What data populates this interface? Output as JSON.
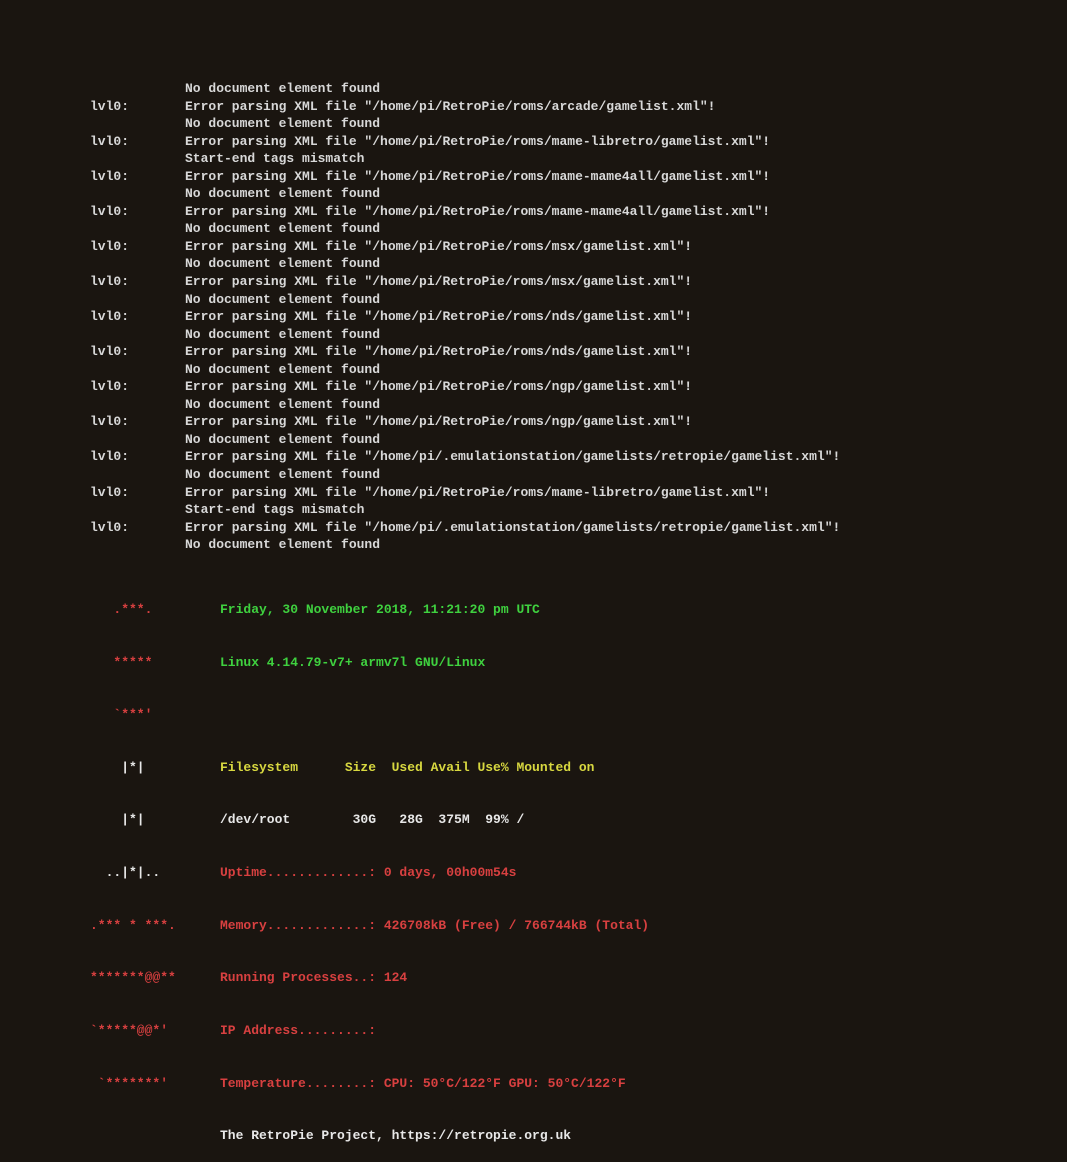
{
  "log_lines": [
    {
      "prefix": "",
      "msg": "No document element found"
    },
    {
      "prefix": "lvl0:",
      "msg": "Error parsing XML file \"/home/pi/RetroPie/roms/arcade/gamelist.xml\"!"
    },
    {
      "prefix": "",
      "msg": "No document element found"
    },
    {
      "prefix": "lvl0:",
      "msg": "Error parsing XML file \"/home/pi/RetroPie/roms/mame-libretro/gamelist.xml\"!"
    },
    {
      "prefix": "",
      "msg": "Start-end tags mismatch"
    },
    {
      "prefix": "lvl0:",
      "msg": "Error parsing XML file \"/home/pi/RetroPie/roms/mame-mame4all/gamelist.xml\"!"
    },
    {
      "prefix": "",
      "msg": "No document element found"
    },
    {
      "prefix": "lvl0:",
      "msg": "Error parsing XML file \"/home/pi/RetroPie/roms/mame-mame4all/gamelist.xml\"!"
    },
    {
      "prefix": "",
      "msg": "No document element found"
    },
    {
      "prefix": "lvl0:",
      "msg": "Error parsing XML file \"/home/pi/RetroPie/roms/msx/gamelist.xml\"!"
    },
    {
      "prefix": "",
      "msg": "No document element found"
    },
    {
      "prefix": "lvl0:",
      "msg": "Error parsing XML file \"/home/pi/RetroPie/roms/msx/gamelist.xml\"!"
    },
    {
      "prefix": "",
      "msg": "No document element found"
    },
    {
      "prefix": "lvl0:",
      "msg": "Error parsing XML file \"/home/pi/RetroPie/roms/nds/gamelist.xml\"!"
    },
    {
      "prefix": "",
      "msg": "No document element found"
    },
    {
      "prefix": "lvl0:",
      "msg": "Error parsing XML file \"/home/pi/RetroPie/roms/nds/gamelist.xml\"!"
    },
    {
      "prefix": "",
      "msg": "No document element found"
    },
    {
      "prefix": "lvl0:",
      "msg": "Error parsing XML file \"/home/pi/RetroPie/roms/ngp/gamelist.xml\"!"
    },
    {
      "prefix": "",
      "msg": "No document element found"
    },
    {
      "prefix": "lvl0:",
      "msg": "Error parsing XML file \"/home/pi/RetroPie/roms/ngp/gamelist.xml\"!"
    },
    {
      "prefix": "",
      "msg": "No document element found"
    },
    {
      "prefix": "lvl0:",
      "msg": "Error parsing XML file \"/home/pi/.emulationstation/gamelists/retropie/gamelist.xml\"!"
    },
    {
      "prefix": "",
      "msg": "No document element found"
    },
    {
      "prefix": "lvl0:",
      "msg": "Error parsing XML file \"/home/pi/RetroPie/roms/mame-libretro/gamelist.xml\"!"
    },
    {
      "prefix": "",
      "msg": "Start-end tags mismatch"
    },
    {
      "prefix": "lvl0:",
      "msg": "Error parsing XML file \"/home/pi/.emulationstation/gamelists/retropie/gamelist.xml\"!"
    },
    {
      "prefix": "",
      "msg": "No document element found"
    }
  ],
  "info": {
    "ascii": [
      "   .***.     ",
      "   *****     ",
      "   `***'     ",
      "    |*|      ",
      "    |*|      ",
      "  ..|*|..    ",
      ".*** * ***.  ",
      "*******@@**  ",
      "`*****@@*'   ",
      " `*******'   "
    ],
    "datetime": "Friday, 30 November 2018, 11:21:20 pm UTC",
    "kernel": "Linux 4.14.79-v7+ armv7l GNU/Linux",
    "fs_header": "Filesystem      Size  Used Avail Use% Mounted on",
    "fs_row": "/dev/root        30G   28G  375M  99% /",
    "uptime_label": "Uptime.............: ",
    "uptime_value": "0 days, 00h00m54s",
    "memory_label": "Memory.............: ",
    "memory_value": "426708kB (Free) / 766744kB (Total)",
    "procs_label": "Running Processes..: ",
    "procs_value": "124",
    "ip_label": "IP Address.........: ",
    "ip_value": "",
    "temp_label": "Temperature........: ",
    "temp_value": "CPU: 50°C/122°F GPU: 50°C/122°F",
    "footer": "The RetroPie Project, https://retropie.org.uk"
  }
}
